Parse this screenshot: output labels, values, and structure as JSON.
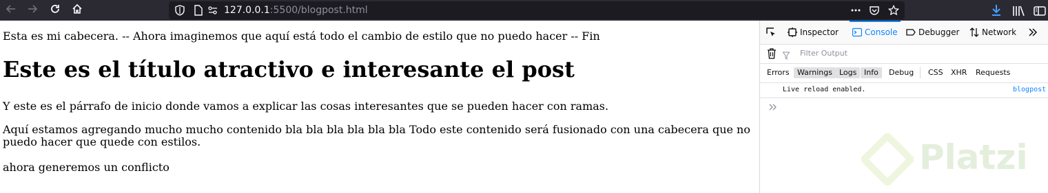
{
  "browser": {
    "url_host": "127.0.0.1",
    "url_port": ":5500",
    "url_path": "/blogpost.html"
  },
  "page": {
    "header_text": "Esta es mi cabecera. -- Ahora imaginemos que aquí está todo el cambio de estilo que no puedo hacer -- Fin",
    "title": "Este es el título atractivo e interesante el post",
    "paragraph_1": "Y este es el párrafo de inicio donde vamos a explicar las cosas interesantes que se pueden hacer con ramas.",
    "paragraph_2": "Aquí estamos agregando mucho mucho contenido bla bla bla bla bla bla Todo este contenido será fusionado con una cabecera que no puedo hacer que quede con estilos.",
    "paragraph_3": "ahora generemos un conflicto"
  },
  "devtools": {
    "tabs": [
      "Inspector",
      "Console",
      "Debugger",
      "Network"
    ],
    "active_tab": "Console",
    "filter_placeholder": "Filter Output",
    "categories": [
      "Errors",
      "Warnings",
      "Logs",
      "Info",
      "Debug",
      "CSS",
      "XHR",
      "Requests"
    ],
    "message": "Live reload enabled.",
    "message_source": "blogpost"
  },
  "watermark": {
    "text": "Platzi"
  },
  "colors": {
    "toolbar_bg": "#2b2a33",
    "urlbar_bg": "#1c1b22",
    "accent": "#0a84ff",
    "platzi_green": "#98ca3f"
  }
}
